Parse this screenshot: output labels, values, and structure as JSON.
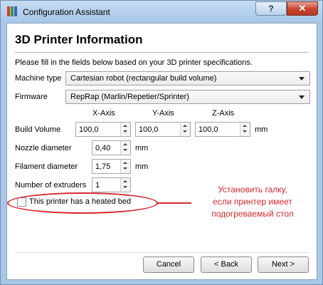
{
  "window": {
    "title": "Configuration Assistant",
    "help_label": "?",
    "close_label": "✕",
    "app_icon_colors": [
      "#d23b2e",
      "#3a9b3a",
      "#3566c4"
    ]
  },
  "page": {
    "title": "3D Printer Information",
    "intro": "Please fill in the fields below based on your 3D printer specifications."
  },
  "machine_type": {
    "label": "Machine type",
    "value": "Cartesian robot (rectangular build volume)"
  },
  "firmware": {
    "label": "Firmware",
    "value": "RepRap (Marlin/Repetier/Sprinter)"
  },
  "build_volume": {
    "label": "Build Volume",
    "axes": [
      "X-Axis",
      "Y-Axis",
      "Z-Axis"
    ],
    "values": [
      "100,0",
      "100,0",
      "100,0"
    ],
    "unit": "mm"
  },
  "nozzle": {
    "label": "Nozzle diameter",
    "value": "0,40",
    "unit": "mm"
  },
  "filament": {
    "label": "Filament diameter",
    "value": "1,75",
    "unit": "mm"
  },
  "extruders": {
    "label": "Number of extruders",
    "value": "1"
  },
  "heated_bed": {
    "label": "This printer has a heated bed",
    "checked": false
  },
  "annotation": {
    "lines": [
      "Установить галку,",
      "если принтер имеет",
      "подогреваемый стол"
    ],
    "color": "#d7282d"
  },
  "buttons": {
    "cancel": "Cancel",
    "back": "< Back",
    "next": "Next >"
  }
}
